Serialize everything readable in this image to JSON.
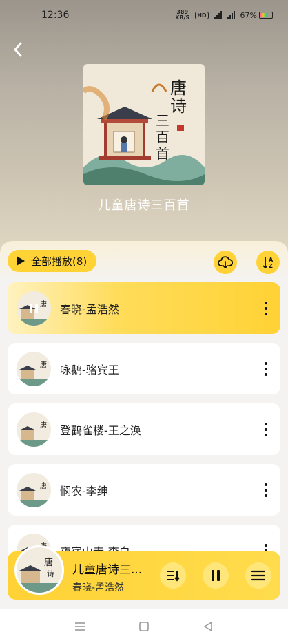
{
  "status_bar": {
    "time": "12:36",
    "net_speed_value": "389",
    "net_speed_unit": "KB/S",
    "hd_label": "HD",
    "battery": "67%"
  },
  "header": {
    "back_icon": "chevron-left-icon",
    "cover_calligraphy": [
      "唐",
      "诗",
      "三",
      "百",
      "首"
    ],
    "album_title": "儿童唐诗三百首"
  },
  "toolbar": {
    "play_all_label": "全部播放(8)",
    "download_icon": "cloud-download-icon",
    "sort_icon": "sort-icon"
  },
  "songs": [
    {
      "title": "春晓-孟浩然",
      "active": true
    },
    {
      "title": "咏鹅-骆宾王",
      "active": false
    },
    {
      "title": "登鹳雀楼-王之涣",
      "active": false
    },
    {
      "title": "悯农-李绅",
      "active": false
    },
    {
      "title": "夜宿山寺-李白",
      "active": false
    }
  ],
  "mini_player": {
    "title": "儿童唐诗三...",
    "subtitle": "春晓-孟浩然"
  },
  "colors": {
    "accent": "#ffd235",
    "active_row": "#ffdc5a"
  }
}
